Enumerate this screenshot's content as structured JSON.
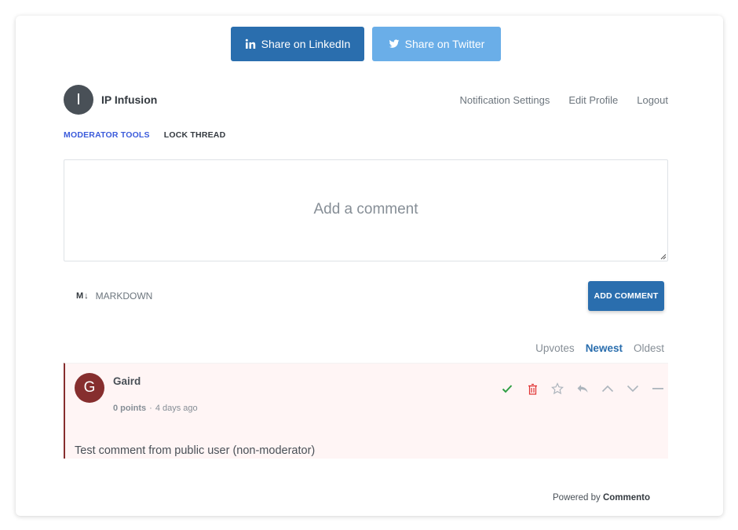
{
  "share": {
    "linkedin_label": "Share on LinkedIn",
    "twitter_label": "Share on Twitter"
  },
  "user": {
    "avatar_initial": "I",
    "name": "IP Infusion",
    "links": [
      "Notification Settings",
      "Edit Profile",
      "Logout"
    ]
  },
  "moderator": {
    "tools_label": "MODERATOR TOOLS",
    "lock_label": "LOCK THREAD"
  },
  "composer": {
    "placeholder": "Add a comment",
    "markdown_icon": "M↓",
    "markdown_label": "MARKDOWN",
    "submit_label": "ADD COMMENT"
  },
  "sort": {
    "options": [
      "Upvotes",
      "Newest",
      "Oldest"
    ],
    "active": "Newest"
  },
  "comments": [
    {
      "avatar_initial": "G",
      "author": "Gaird",
      "points": "0 points",
      "separator": "·",
      "time": "4 days ago",
      "body": "Test comment from public user (non-moderator)"
    }
  ],
  "footer": {
    "powered_prefix": "Powered by",
    "brand": "Commento"
  },
  "colors": {
    "primary": "#2a6eae",
    "twitter": "#6aaee8",
    "accent_link": "#3b5bdb",
    "comment_bg": "#fff5f5",
    "comment_border": "#862e2e",
    "approve": "#2f9e44",
    "delete": "#e03131"
  }
}
